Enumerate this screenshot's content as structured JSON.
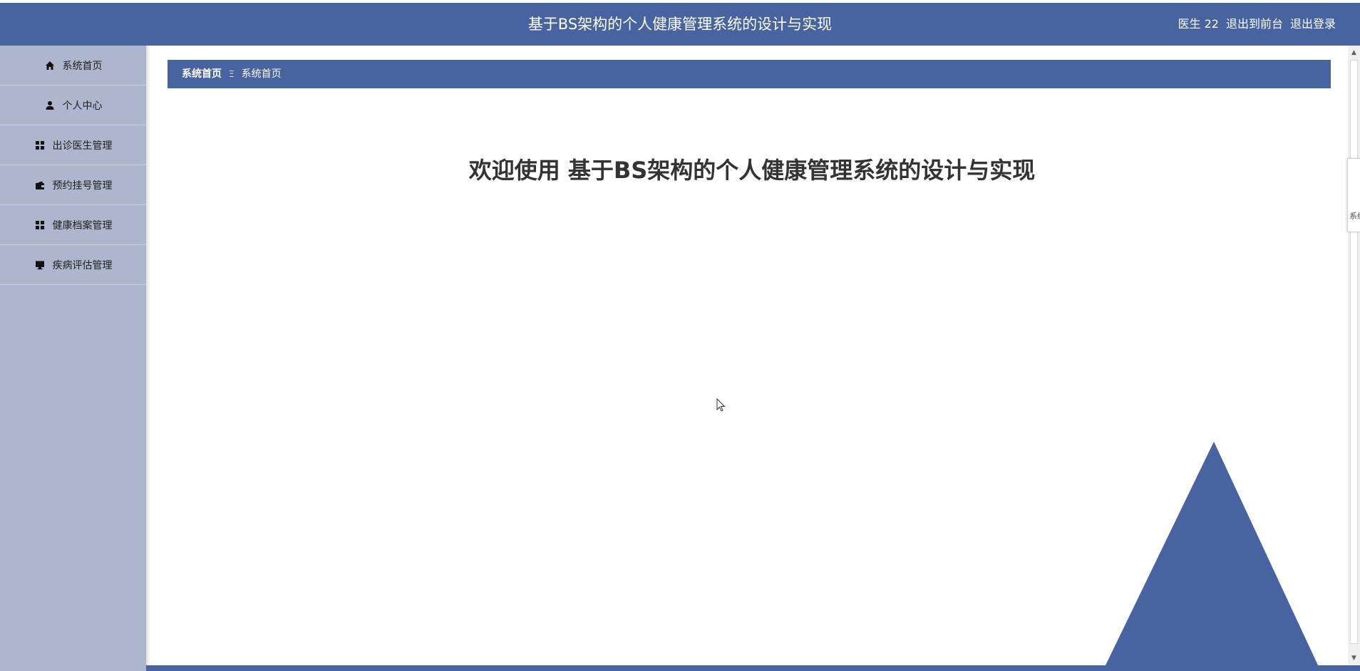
{
  "header": {
    "title": "基于BS架构的个人健康管理系统的设计与实现",
    "user": "医生 22",
    "to_frontend": "退出到前台",
    "logout": "退出登录"
  },
  "sidebar": {
    "items": [
      {
        "label": "系统首页",
        "icon": "home-icon"
      },
      {
        "label": "个人中心",
        "icon": "user-icon"
      },
      {
        "label": "出诊医生管理",
        "icon": "grid-icon"
      },
      {
        "label": "预约挂号管理",
        "icon": "wallet-icon"
      },
      {
        "label": "健康档案管理",
        "icon": "grid-icon"
      },
      {
        "label": "疾病评估管理",
        "icon": "monitor-icon"
      }
    ]
  },
  "breadcrumb": {
    "home": "系统首页",
    "separator": "Ξ",
    "current": "系统首页"
  },
  "main": {
    "welcome": "欢迎使用 基于BS架构的个人健康管理系统的设计与实现"
  },
  "side_tab": {
    "text": "系统"
  },
  "colors": {
    "accent": "#4763a0",
    "sidebar_bg": "#adb6cc"
  }
}
